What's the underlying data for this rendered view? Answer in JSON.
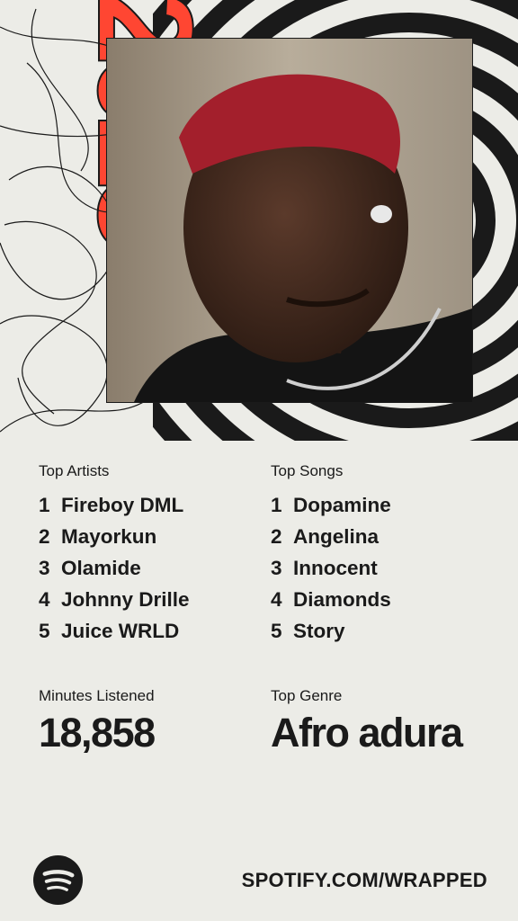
{
  "top_artists": {
    "title": "Top Artists",
    "items": [
      {
        "rank": "1",
        "name": "Fireboy DML"
      },
      {
        "rank": "2",
        "name": "Mayorkun"
      },
      {
        "rank": "3",
        "name": "Olamide"
      },
      {
        "rank": "4",
        "name": "Johnny Drille"
      },
      {
        "rank": "5",
        "name": "Juice WRLD"
      }
    ]
  },
  "top_songs": {
    "title": "Top Songs",
    "items": [
      {
        "rank": "1",
        "name": "Dopamine"
      },
      {
        "rank": "2",
        "name": "Angelina"
      },
      {
        "rank": "3",
        "name": "Innocent"
      },
      {
        "rank": "4",
        "name": "Diamonds"
      },
      {
        "rank": "5",
        "name": "Story"
      }
    ]
  },
  "minutes": {
    "label": "Minutes Listened",
    "value": "18,858"
  },
  "genre": {
    "label": "Top Genre",
    "value": "Afro adura"
  },
  "footer": {
    "url": "SPOTIFY.COM/WRAPPED",
    "logo_icon": "spotify-logo-icon"
  },
  "art": {
    "year_text": "2025",
    "accent": "#ff4632",
    "ink": "#1a1a1a"
  }
}
